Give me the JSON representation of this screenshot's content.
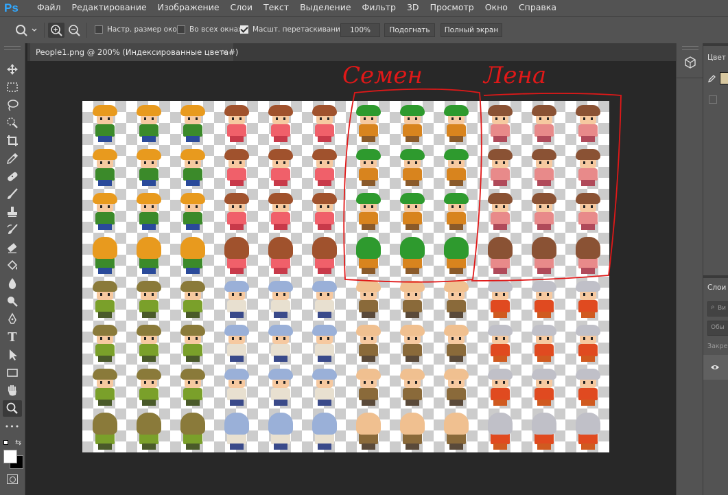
{
  "app": {
    "logo": "Ps"
  },
  "menu": [
    "Файл",
    "Редактирование",
    "Изображение",
    "Слои",
    "Текст",
    "Выделение",
    "Фильтр",
    "3D",
    "Просмотр",
    "Окно",
    "Справка"
  ],
  "options": {
    "resize_windows": {
      "label": "Настр. размер окон",
      "checked": false
    },
    "all_windows": {
      "label": "Во всех окнах",
      "checked": false
    },
    "scrubby_zoom": {
      "label": "Масшт. перетаскиванием",
      "checked": true
    },
    "zoom_100": "100%",
    "fit_screen": "Подогнать",
    "full_screen": "Полный экран"
  },
  "document": {
    "tab_title": "People1.png @ 200% (Индексированные цвета#)",
    "close_glyph": "×"
  },
  "tools": [
    "move-icon",
    "marquee-icon",
    "lasso-icon",
    "quick-select-icon",
    "crop-icon",
    "eyedropper-icon",
    "healing-brush-icon",
    "brush-icon",
    "clone-stamp-icon",
    "history-brush-icon",
    "eraser-icon",
    "paint-bucket-icon",
    "blur-icon",
    "dodge-icon",
    "pen-icon",
    "type-icon",
    "path-select-icon",
    "rectangle-icon",
    "hand-icon",
    "zoom-icon",
    "more-tools-icon"
  ],
  "tool_labels": {
    "type": "T",
    "more": "•••"
  },
  "annotations": {
    "label_1": "Семен",
    "label_2": "Лена"
  },
  "right_panel": {
    "color_tab": "Цвет",
    "layers_tab": "Слои",
    "search_hint": "Ви",
    "blend_mode": "Обы",
    "lock_label": "Закре"
  },
  "colors": {
    "accent": "#31a8ff",
    "annotation": "#e01818",
    "foreground": "#ffffff",
    "background": "#000000"
  }
}
